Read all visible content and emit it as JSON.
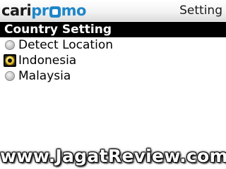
{
  "header": {
    "logo": {
      "part_cari": "cari",
      "part_pr": "pr",
      "part_mo": "mo",
      "badge_icon": "logo-badge-icon"
    },
    "title": "Setting"
  },
  "section": {
    "title": "Country Setting"
  },
  "options": [
    {
      "label": "Detect Location",
      "selected": false,
      "icon": "radio-unselected-icon"
    },
    {
      "label": "Indonesia",
      "selected": true,
      "icon": "radio-selected-icon"
    },
    {
      "label": "Malaysia",
      "selected": false,
      "icon": "radio-unselected-icon"
    }
  ],
  "watermark": "www.JagatReview.com",
  "colors": {
    "brand_blue": "#1e86c8",
    "section_header_bg": "#000000",
    "radio_selected": "#f0d040"
  }
}
